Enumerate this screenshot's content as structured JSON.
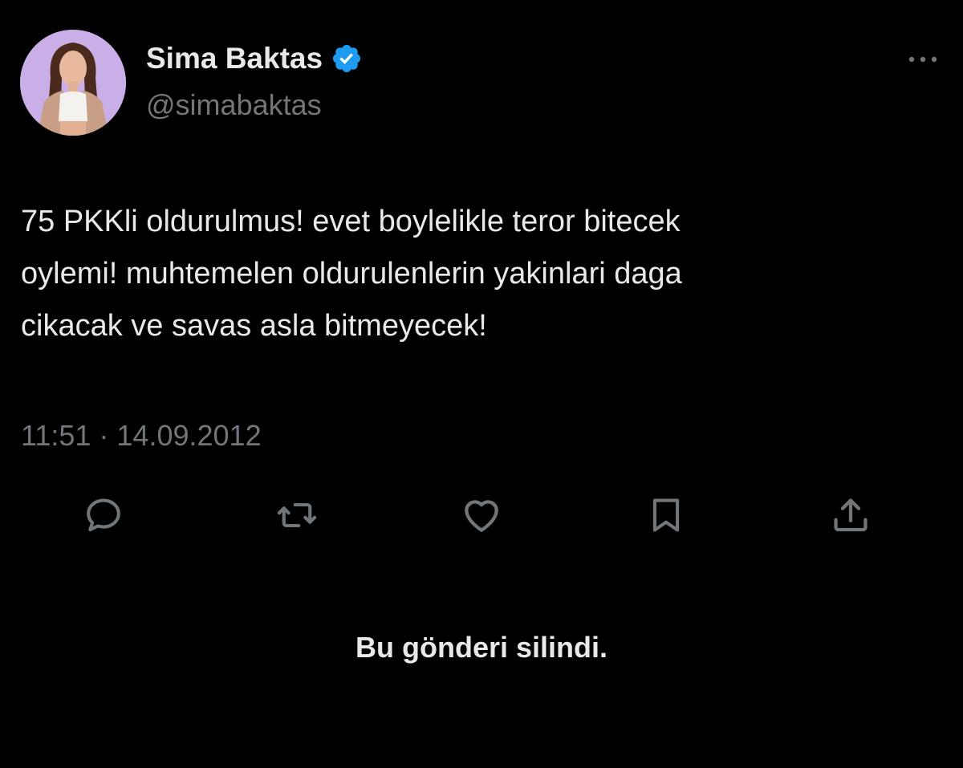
{
  "author": {
    "display_name": "Sima Baktas",
    "handle": "@simabaktas",
    "verified_icon": "verified-badge-icon",
    "avatar_icon": "profile-photo"
  },
  "tweet": {
    "lines": [
      "75 PKKli oldurulmus! evet boylelikle teror bitecek",
      "oylemi! muhtemelen oldurulenlerin yakinlari daga",
      "cikacak ve savas asla bitmeyecek!"
    ],
    "timestamp": "11:51 · 14.09.2012"
  },
  "actions": [
    {
      "icon": "reply-icon"
    },
    {
      "icon": "retweet-icon"
    },
    {
      "icon": "like-icon"
    },
    {
      "icon": "bookmark-icon"
    },
    {
      "icon": "share-icon"
    }
  ],
  "more_icon": "more-options-icon",
  "notice": "Bu gönderi silindi.",
  "colors": {
    "background": "#000000",
    "primary_text": "#e7e9ea",
    "secondary_text": "#71767b",
    "verified_blue": "#1d9bf0",
    "avatar_bg": "#c9aee8"
  }
}
